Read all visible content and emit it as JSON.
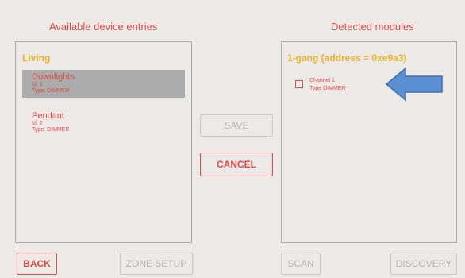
{
  "left_panel": {
    "title": "Available device entries",
    "group": "Living",
    "devices": [
      {
        "name": "Downlights",
        "id_text": "Id:   1",
        "type_text": "Type:   DIMMER",
        "selected": true
      },
      {
        "name": "Pendant",
        "id_text": "Id:   2",
        "type_text": "Type:   DIMMER",
        "selected": false
      }
    ]
  },
  "right_panel": {
    "title": "Detected modules",
    "module_title": "1-gang (address = 0xe9a3)",
    "channel_text": "Channel   1",
    "type_text": "Type   DIMMER",
    "checked": false
  },
  "buttons": {
    "save": "SAVE",
    "cancel": "CANCEL",
    "back": "BACK",
    "zone_setup": "ZONE SETUP",
    "scan": "SCAN",
    "discovery": "DISCOVERY"
  },
  "colors": {
    "accent": "#d94a4a",
    "group_title": "#e8b12b",
    "selection": "#ababab",
    "arrow_fill": "#5b8fd1",
    "arrow_stroke": "#3b6fae"
  },
  "icons": {
    "callout": "arrow-left-icon"
  }
}
